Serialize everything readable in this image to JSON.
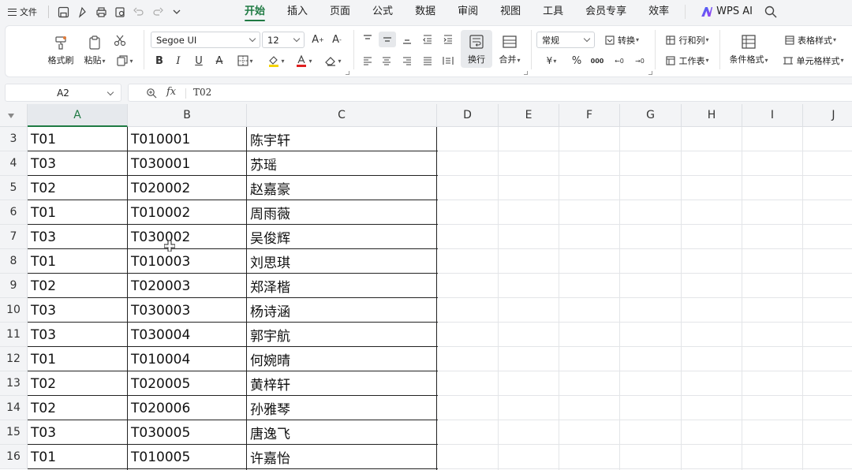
{
  "menubar": {
    "file_label": "文件",
    "tabs": [
      "开始",
      "插入",
      "页面",
      "公式",
      "数据",
      "审阅",
      "视图",
      "工具",
      "会员专享",
      "效率"
    ],
    "ai_label": "WPS AI"
  },
  "ribbon": {
    "format_painter": "格式刷",
    "paste": "粘贴",
    "font_name": "Segoe UI",
    "font_size": "12",
    "bold": "B",
    "italic": "I",
    "underline": "U",
    "strike": "A",
    "wrap": "换行",
    "merge": "合并",
    "number_format": "常规",
    "convert": "转换",
    "rows_cols": "行和列",
    "worksheet": "工作表",
    "cond_format": "条件格式",
    "table_style": "表格样式",
    "cell_style": "单元格样式",
    "currency": "¥",
    "percent": "%"
  },
  "formula_bar": {
    "cell_ref": "A2",
    "fx": "fx",
    "value": "T02"
  },
  "sheet": {
    "columns": [
      "A",
      "B",
      "C",
      "D",
      "E",
      "F",
      "G",
      "H",
      "I",
      "J"
    ],
    "rows": [
      {
        "num": "3",
        "a": "T01",
        "b": "T010001",
        "c": "陈宇轩"
      },
      {
        "num": "4",
        "a": "T03",
        "b": "T030001",
        "c": "苏瑶"
      },
      {
        "num": "5",
        "a": "T02",
        "b": "T020002",
        "c": "赵嘉豪"
      },
      {
        "num": "6",
        "a": "T01",
        "b": "T010002",
        "c": "周雨薇"
      },
      {
        "num": "7",
        "a": "T03",
        "b": "T030002",
        "c": "吴俊辉"
      },
      {
        "num": "8",
        "a": "T01",
        "b": "T010003",
        "c": "刘思琪"
      },
      {
        "num": "9",
        "a": "T02",
        "b": "T020003",
        "c": "郑泽楷"
      },
      {
        "num": "10",
        "a": "T03",
        "b": "T030003",
        "c": "杨诗涵"
      },
      {
        "num": "11",
        "a": "T03",
        "b": "T030004",
        "c": "郭宇航"
      },
      {
        "num": "12",
        "a": "T01",
        "b": "T010004",
        "c": "何婉晴"
      },
      {
        "num": "13",
        "a": "T02",
        "b": "T020005",
        "c": "黄梓轩"
      },
      {
        "num": "14",
        "a": "T02",
        "b": "T020006",
        "c": "孙雅琴"
      },
      {
        "num": "15",
        "a": "T03",
        "b": "T030005",
        "c": "唐逸飞"
      },
      {
        "num": "16",
        "a": "T01",
        "b": "T010005",
        "c": "许嘉怡"
      }
    ]
  },
  "colors": {
    "accent": "#1f7a43",
    "chrome": "#f3f4f6",
    "grid": "#e3e5e8"
  }
}
